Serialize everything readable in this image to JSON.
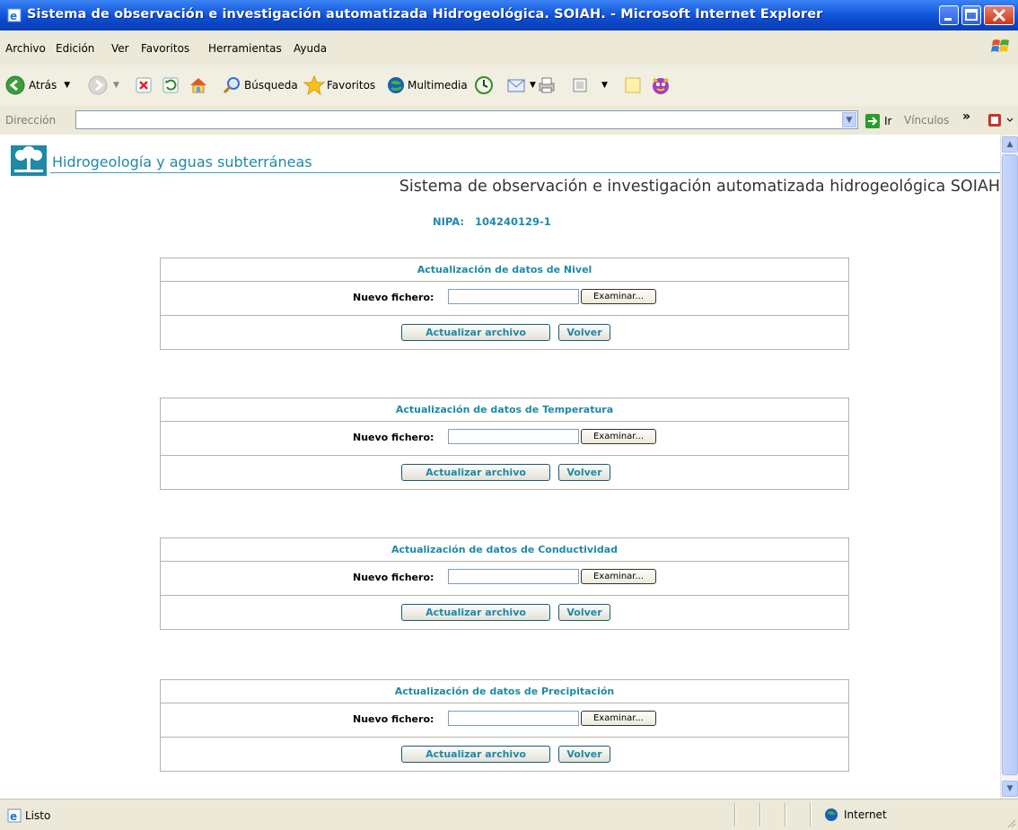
{
  "window": {
    "title": "Sistema de observación e investigación automatizada Hidrogeológica. SOIAH. - Microsoft Internet Explorer",
    "app_icon": "ie-page-icon",
    "controls": [
      "minimize-icon",
      "maximize-icon",
      "close-icon"
    ]
  },
  "menu": {
    "items": [
      "Archivo",
      "Edición",
      "Ver",
      "Favoritos",
      "Herramientas",
      "Ayuda"
    ]
  },
  "toolbar": {
    "back_label": "Atrás",
    "search_label": "Búsqueda",
    "favorites_label": "Favoritos",
    "media_label": "Multimedia"
  },
  "address": {
    "label": "Dirección",
    "value": "",
    "go_label": "Ir",
    "links_label": "Vínculos",
    "more": "»"
  },
  "page": {
    "logo_text": "Hidrogeología y aguas subterráneas",
    "system_title": "Sistema de observación e investigación automatizada hidrogeológica SOIAH",
    "nipa_label": "NIPA:",
    "nipa_value": "104240129-1",
    "panels": [
      {
        "title": "Actualización de datos de Nivel",
        "file_label": "Nuevo fichero:",
        "browse_label": "Examinar...",
        "update_label": "Actualizar archivo",
        "back_label": "Volver"
      },
      {
        "title": "Actualización de datos de Temperatura",
        "file_label": "Nuevo fichero:",
        "browse_label": "Examinar...",
        "update_label": "Actualizar archivo",
        "back_label": "Volver"
      },
      {
        "title": "Actualización de datos de Conductividad",
        "file_label": "Nuevo fichero:",
        "browse_label": "Examinar...",
        "update_label": "Actualizar archivo",
        "back_label": "Volver"
      },
      {
        "title": "Actualización de datos de Precipitación",
        "file_label": "Nuevo fichero:",
        "browse_label": "Examinar...",
        "update_label": "Actualizar archivo",
        "back_label": "Volver"
      }
    ]
  },
  "status": {
    "text": "Listo",
    "zone": "Internet"
  },
  "colors": {
    "accent": "#1e8aa5",
    "titlebar": "#0a47c9",
    "chrome": "#ece9d8"
  }
}
